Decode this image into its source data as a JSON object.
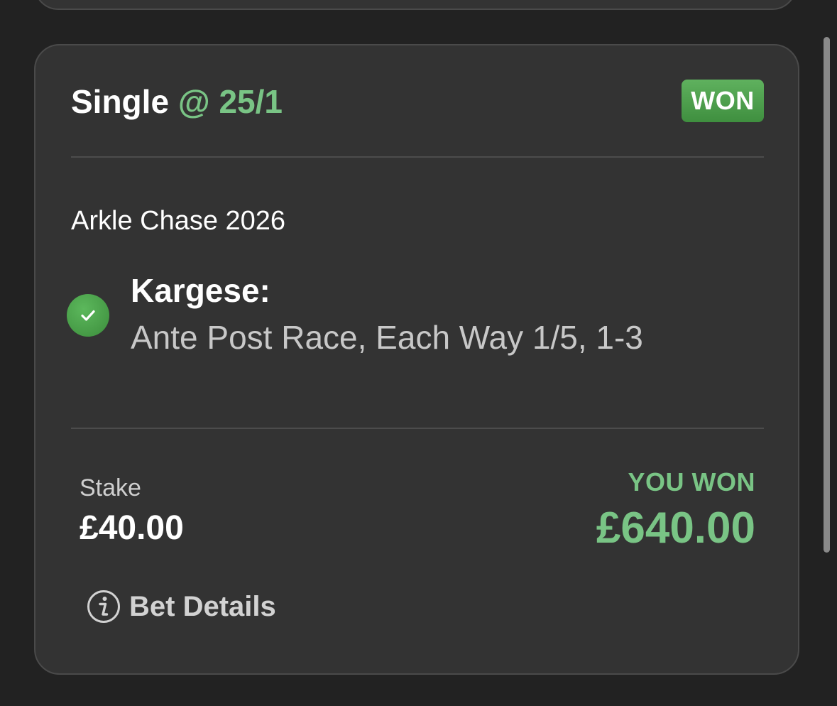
{
  "bet": {
    "type_label": "Single",
    "odds_label": "@ 25/1",
    "status": "WON",
    "event": "Arkle Chase 2026",
    "selection": "Kargese:",
    "market": "Ante Post Race, Each Way 1/5, 1-3",
    "stake_label": "Stake",
    "stake_value": "£40.00",
    "returns_label": "YOU WON",
    "returns_value": "£640.00",
    "details_label": "Bet Details"
  },
  "colors": {
    "background": "#222222",
    "card": "#333333",
    "accent_green": "#79c485",
    "badge_green": "#4fa14f"
  },
  "icons": {
    "selection_status": "check-circle-icon",
    "details": "info-circle-icon"
  }
}
